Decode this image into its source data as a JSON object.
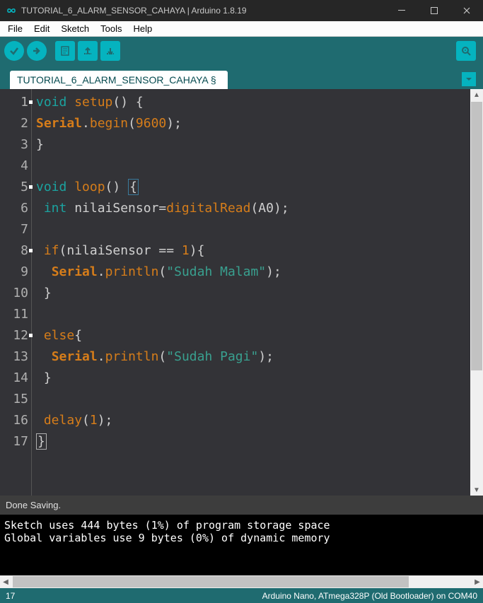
{
  "window": {
    "title": "TUTORIAL_6_ALARM_SENSOR_CAHAYA | Arduino 1.8.19"
  },
  "menu": {
    "file": "File",
    "edit": "Edit",
    "sketch": "Sketch",
    "tools": "Tools",
    "help": "Help"
  },
  "tab": {
    "label": "TUTORIAL_6_ALARM_SENSOR_CAHAYA §"
  },
  "code": {
    "lines": [
      {
        "n": "1",
        "tokens": [
          {
            "t": "void ",
            "c": "kw"
          },
          {
            "t": "setup",
            "c": "fn"
          },
          {
            "t": "() {",
            "c": "punct"
          }
        ]
      },
      {
        "n": "2",
        "tokens": [
          {
            "t": "Serial",
            "c": "cls"
          },
          {
            "t": ".",
            "c": "punct"
          },
          {
            "t": "begin",
            "c": "fn"
          },
          {
            "t": "(",
            "c": "punct"
          },
          {
            "t": "9600",
            "c": "num"
          },
          {
            "t": ");",
            "c": "punct"
          }
        ]
      },
      {
        "n": "3",
        "tokens": [
          {
            "t": "}",
            "c": "punct"
          }
        ]
      },
      {
        "n": "4",
        "tokens": []
      },
      {
        "n": "5",
        "tokens": [
          {
            "t": "void ",
            "c": "kw"
          },
          {
            "t": "loop",
            "c": "fn"
          },
          {
            "t": "() ",
            "c": "punct"
          },
          {
            "t": "{",
            "c": "punct",
            "hl": true
          }
        ]
      },
      {
        "n": "6",
        "tokens": [
          {
            "t": " ",
            "c": ""
          },
          {
            "t": "int ",
            "c": "type"
          },
          {
            "t": "nilaiSensor=",
            "c": "ident"
          },
          {
            "t": "digitalRead",
            "c": "fn"
          },
          {
            "t": "(A0);",
            "c": "punct"
          }
        ]
      },
      {
        "n": "7",
        "tokens": []
      },
      {
        "n": "8",
        "tokens": [
          {
            "t": " ",
            "c": ""
          },
          {
            "t": "if",
            "c": "fn"
          },
          {
            "t": "(nilaiSensor == ",
            "c": "ident"
          },
          {
            "t": "1",
            "c": "num"
          },
          {
            "t": "){",
            "c": "punct"
          }
        ]
      },
      {
        "n": "9",
        "tokens": [
          {
            "t": "  ",
            "c": ""
          },
          {
            "t": "Serial",
            "c": "cls"
          },
          {
            "t": ".",
            "c": "punct"
          },
          {
            "t": "println",
            "c": "fn"
          },
          {
            "t": "(",
            "c": "punct"
          },
          {
            "t": "\"Sudah Malam\"",
            "c": "str"
          },
          {
            "t": ");",
            "c": "punct"
          }
        ]
      },
      {
        "n": "10",
        "tokens": [
          {
            "t": " }",
            "c": "punct"
          }
        ]
      },
      {
        "n": "11",
        "tokens": []
      },
      {
        "n": "12",
        "tokens": [
          {
            "t": " ",
            "c": ""
          },
          {
            "t": "else",
            "c": "fn"
          },
          {
            "t": "{",
            "c": "punct"
          }
        ]
      },
      {
        "n": "13",
        "tokens": [
          {
            "t": "  ",
            "c": ""
          },
          {
            "t": "Serial",
            "c": "cls"
          },
          {
            "t": ".",
            "c": "punct"
          },
          {
            "t": "println",
            "c": "fn"
          },
          {
            "t": "(",
            "c": "punct"
          },
          {
            "t": "\"Sudah Pagi\"",
            "c": "str"
          },
          {
            "t": ");",
            "c": "punct"
          }
        ]
      },
      {
        "n": "14",
        "tokens": [
          {
            "t": " }",
            "c": "punct"
          }
        ]
      },
      {
        "n": "15",
        "tokens": []
      },
      {
        "n": "16",
        "tokens": [
          {
            "t": " ",
            "c": ""
          },
          {
            "t": "delay",
            "c": "fn"
          },
          {
            "t": "(",
            "c": "punct"
          },
          {
            "t": "1",
            "c": "num"
          },
          {
            "t": ");",
            "c": "punct"
          }
        ]
      },
      {
        "n": "17",
        "tokens": [
          {
            "t": "}",
            "c": "punct",
            "cur": true
          }
        ]
      }
    ],
    "fold_marks": [
      1,
      5,
      8,
      12
    ]
  },
  "status": {
    "message": "Done Saving."
  },
  "console": {
    "line1": "Sketch uses 444 bytes (1%) of program storage space",
    "line2": "Global variables use 9 bytes (0%) of dynamic memory"
  },
  "footer": {
    "left": "17",
    "right": "Arduino Nano, ATmega328P (Old Bootloader) on COM40"
  }
}
